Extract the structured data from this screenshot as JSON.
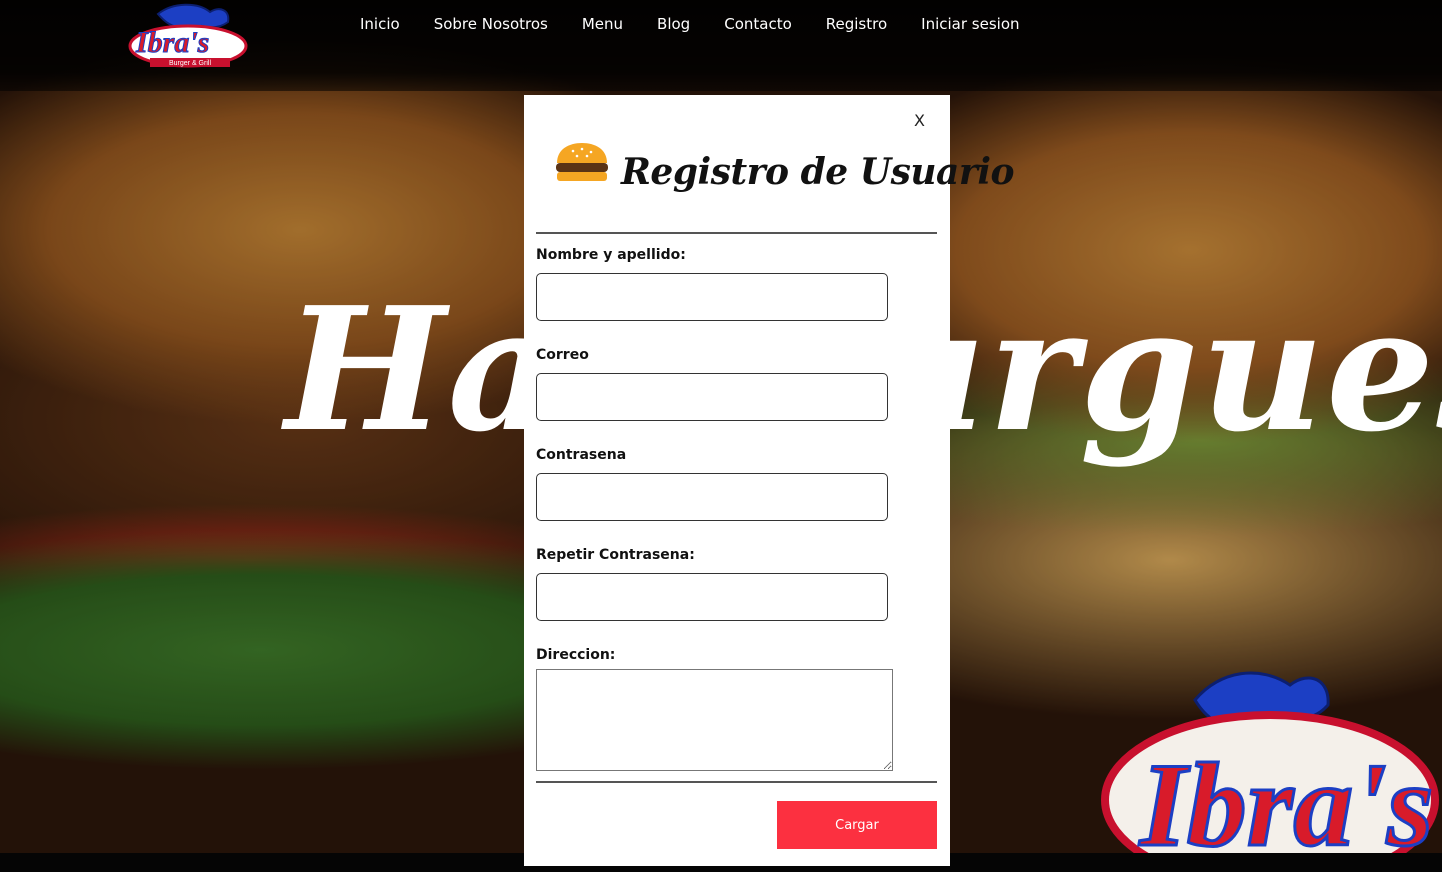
{
  "brand": {
    "logo_text": "Ibra's",
    "logo_subtext": "Burger & Grill"
  },
  "nav": {
    "items": [
      {
        "label": "Inicio"
      },
      {
        "label": "Sobre Nosotros"
      },
      {
        "label": "Menu"
      },
      {
        "label": "Blog"
      },
      {
        "label": "Contacto"
      },
      {
        "label": "Registro"
      },
      {
        "label": "Iniciar sesion"
      }
    ]
  },
  "hero": {
    "title": "Hamburguesas",
    "logo_text": "Ibra's"
  },
  "modal": {
    "close_label": "X",
    "icon": "burger-icon",
    "title": "Registro de Usuario",
    "fields": {
      "name_label": "Nombre y apellido:",
      "email_label": "Correo",
      "password_label": "Contrasena",
      "repeat_password_label": "Repetir Contrasena:",
      "address_label": "Direccion:"
    },
    "submit_label": "Cargar"
  },
  "colors": {
    "accent": "#fc3040",
    "nav_bg": "#000000",
    "modal_bg": "#ffffff"
  }
}
